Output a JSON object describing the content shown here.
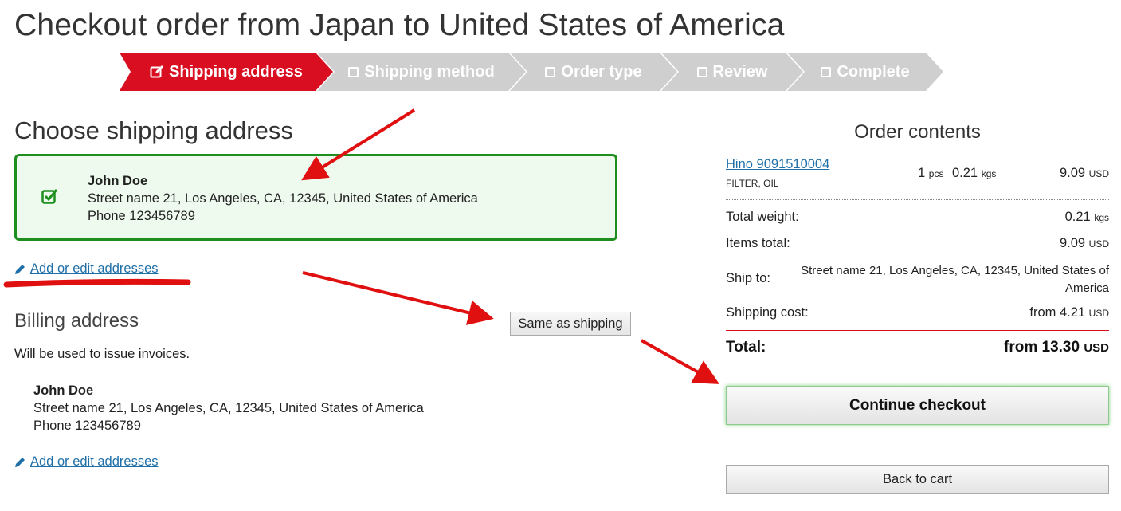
{
  "page_title": "Checkout order from Japan to United States of America",
  "steps": [
    {
      "label": "Shipping address",
      "icon": "edit-icon",
      "active": true
    },
    {
      "label": "Shipping method",
      "icon": "checkbox-icon",
      "active": false
    },
    {
      "label": "Order type",
      "icon": "checkbox-icon",
      "active": false
    },
    {
      "label": "Review",
      "icon": "checkbox-icon",
      "active": false
    },
    {
      "label": "Complete",
      "icon": "checkbox-icon",
      "active": false
    }
  ],
  "shipping": {
    "title": "Choose shipping address",
    "selected_address": {
      "name": "John Doe",
      "street": "Street name 21, Los Angeles, CA, 12345, United States of America",
      "phone": "Phone 123456789"
    },
    "edit_link": "Add or edit addresses"
  },
  "billing": {
    "title": "Billing address",
    "same_button": "Same as shipping",
    "note": "Will be used to issue invoices.",
    "address": {
      "name": "John Doe",
      "street": "Street name 21, Los Angeles, CA, 12345, United States of America",
      "phone": "Phone 123456789"
    },
    "edit_link": "Add or edit addresses"
  },
  "order": {
    "title": "Order contents",
    "item": {
      "part": "Hino 9091510004",
      "description": "FILTER, OIL",
      "qty": "1",
      "qty_unit": "pcs",
      "weight": "0.21",
      "weight_unit": "kgs",
      "price": "9.09",
      "currency": "USD"
    },
    "total_weight_label": "Total weight:",
    "total_weight": "0.21",
    "total_weight_unit": "kgs",
    "items_total_label": "Items total:",
    "items_total": "9.09",
    "items_total_currency": "USD",
    "ship_to_label": "Ship to:",
    "ship_to": "Street name 21, Los Angeles, CA, 12345, United States of America",
    "shipping_cost_label": "Shipping cost:",
    "shipping_cost": "from 4.21",
    "shipping_cost_currency": "USD",
    "total_label": "Total:",
    "total": "from 13.30",
    "total_currency": "USD",
    "continue_button": "Continue checkout",
    "back_button": "Back to cart"
  },
  "colors": {
    "active_step": "#d90f21",
    "inactive_step": "#cfcfcf",
    "selected_border": "#1e8f1e",
    "selected_bg": "#eefaee",
    "link": "#1f6fa8",
    "annotation": "#e01010"
  }
}
